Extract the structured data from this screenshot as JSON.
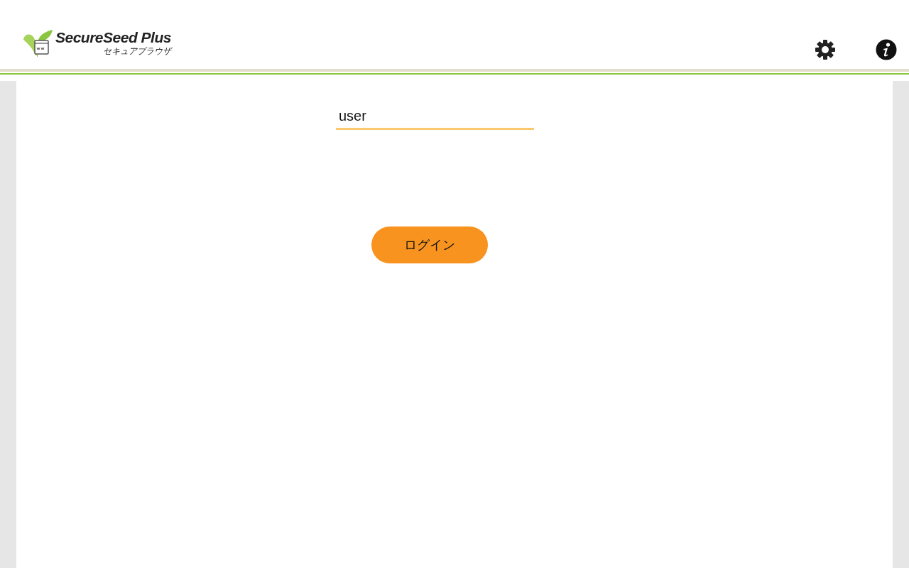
{
  "header": {
    "logo": {
      "name": "SecureSeed Plus",
      "subtitle": "セキュアブラウザ"
    }
  },
  "login": {
    "username": {
      "value": "user"
    },
    "button": "ログイン"
  }
}
